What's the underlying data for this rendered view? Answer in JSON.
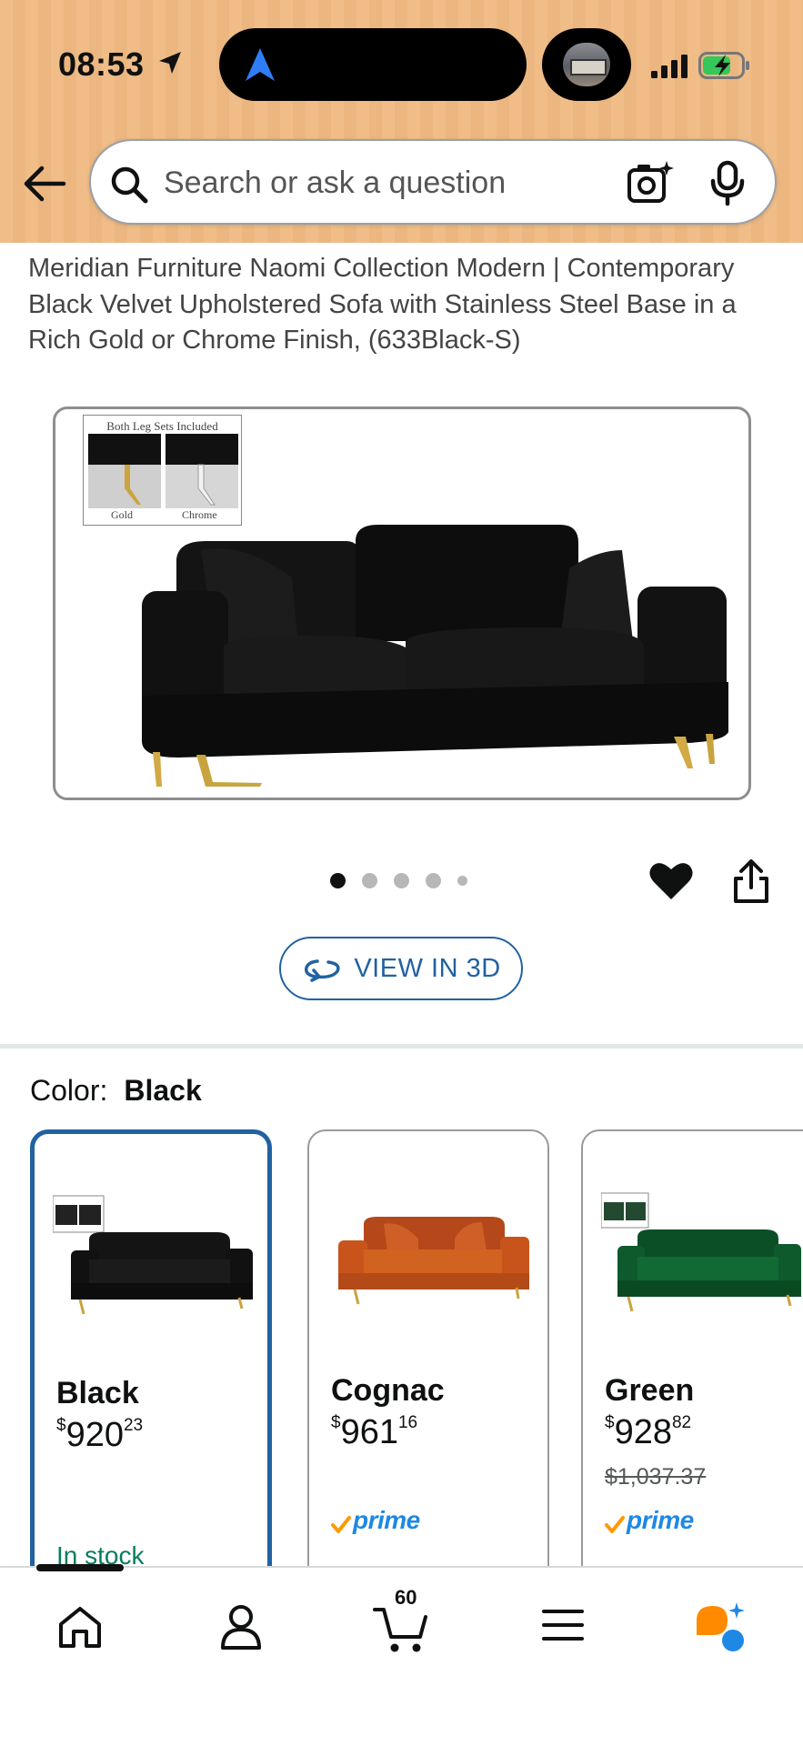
{
  "status_bar": {
    "time": "08:53"
  },
  "search": {
    "placeholder": "Search or ask a question"
  },
  "product": {
    "title": "Meridian Furniture Naomi Collection Modern | Contemporary Black Velvet Upholstered Sofa with Stainless Steel Base in a Rich Gold or Chrome Finish, (633Black-S)",
    "image_inset": {
      "caption": "Both Leg Sets Included",
      "leg_labels": [
        "Gold",
        "Chrome"
      ]
    },
    "carousel_dots": 5,
    "carousel_active_index": 0,
    "view_3d_label": "VIEW IN 3D"
  },
  "color": {
    "label": "Color:",
    "selected": "Black",
    "options": [
      {
        "name": "Black",
        "price_whole": "920",
        "price_fraction": "23",
        "currency": "$",
        "status": "In stock",
        "color": "#111111"
      },
      {
        "name": "Cognac",
        "price_whole": "961",
        "price_fraction": "16",
        "currency": "$",
        "prime": "prime",
        "color": "#c8541c"
      },
      {
        "name": "Green",
        "price_whole": "928",
        "price_fraction": "82",
        "currency": "$",
        "list_price": "$1,037.37",
        "prime": "prime",
        "color": "#0e5a2c"
      }
    ]
  },
  "nav": {
    "cart_count": "60",
    "items": [
      "home-icon",
      "account-icon",
      "cart-icon",
      "menu-icon",
      "rufus-icon"
    ]
  },
  "colors": {
    "header_bg": "#f0bd88",
    "link_blue": "#2162a1",
    "prime_blue": "#1e88e5",
    "prime_check": "#ff9900",
    "in_stock_green": "#067d62"
  }
}
